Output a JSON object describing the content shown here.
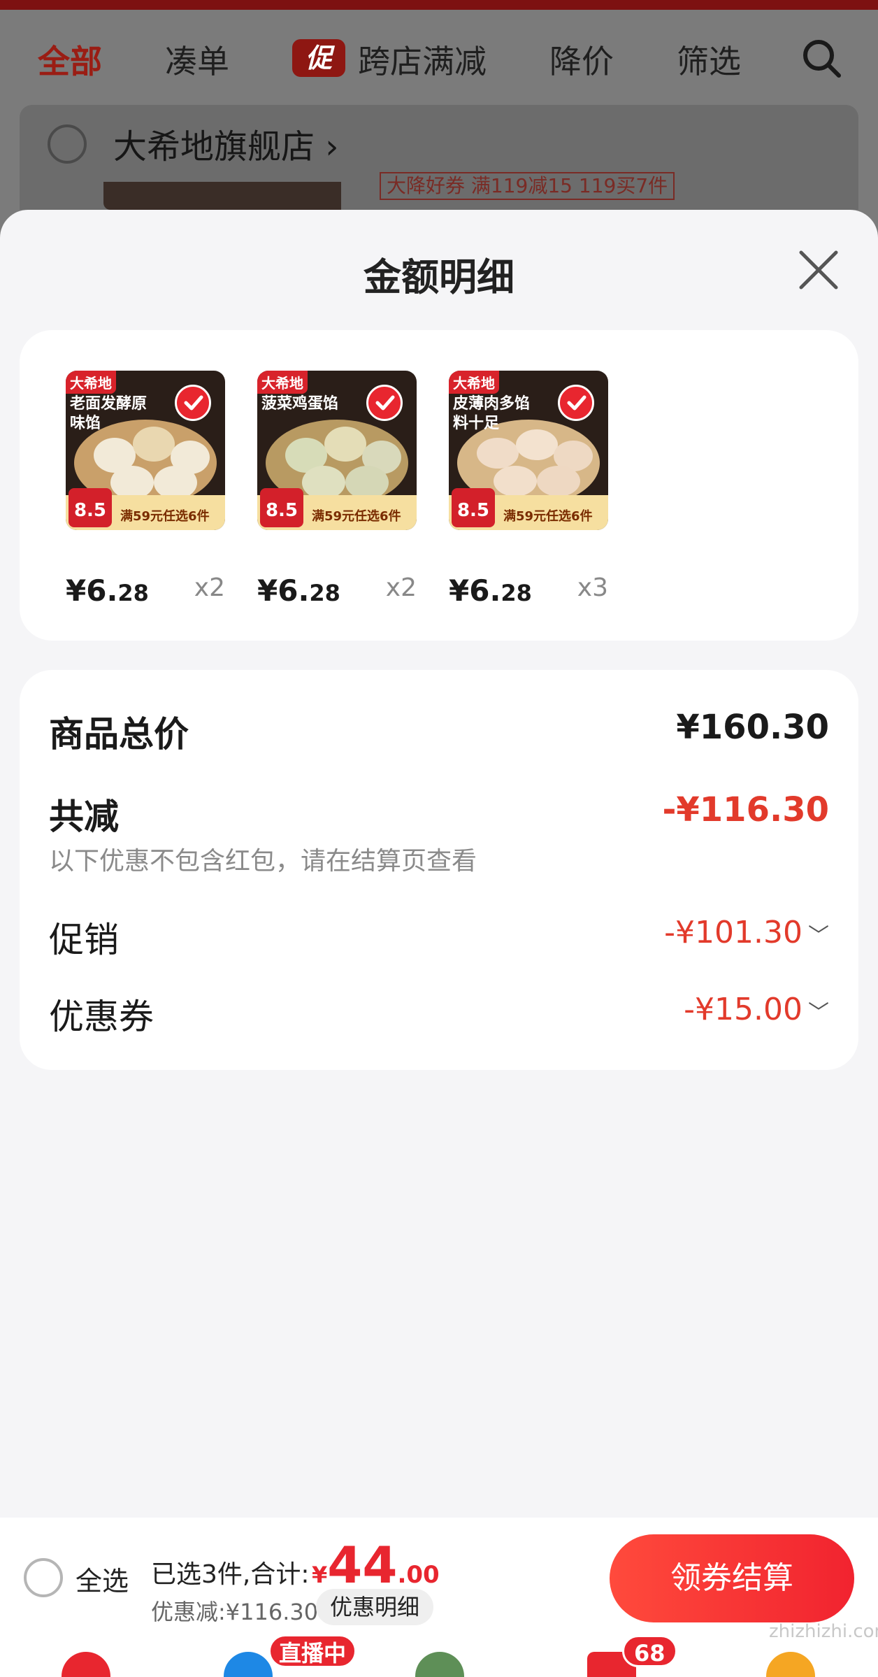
{
  "top_tabs": {
    "all": "全部",
    "bundle": "凑单",
    "promo_badge": "促",
    "cross_store": "跨店满减",
    "price_drop": "降价",
    "filter": "筛选"
  },
  "store": {
    "name": "大希地旗舰店",
    "chevron": "›",
    "peek_tag": "大降好券 满119减15  119买7件"
  },
  "sheet": {
    "title": "金额明细"
  },
  "products": [
    {
      "brand": "大希地",
      "name": "老面发酵原味馅",
      "badge_price": "8.5",
      "promo_text": "满59元任选6件",
      "price_int": "¥6.",
      "price_dec": "28",
      "qty": "x2"
    },
    {
      "brand": "大希地",
      "name": "菠菜鸡蛋馅",
      "badge_price": "8.5",
      "promo_text": "满59元任选6件",
      "price_int": "¥6.",
      "price_dec": "28",
      "qty": "x2"
    },
    {
      "brand": "大希地",
      "name": "皮薄肉多馅料十足",
      "badge_price": "8.5",
      "promo_text": "满59元任选6件",
      "price_int": "¥6.",
      "price_dec": "28",
      "qty": "x3"
    }
  ],
  "summary": {
    "total_label": "商品总价",
    "total_value": "¥160.30",
    "reduce_label": "共减",
    "reduce_value": "-¥116.30",
    "note": "以下优惠不包含红包，请在结算页查看",
    "promo_label": "促销",
    "promo_value": "-¥101.30",
    "coupon_label": "优惠券",
    "coupon_value": "-¥15.00"
  },
  "bottom_bar": {
    "select_all": "全选",
    "summary": "已选3件,合计:",
    "currency": "¥",
    "total_int": "44",
    "total_dec": ".00",
    "saved": "优惠减:¥116.30",
    "detail_button": "优惠明细",
    "pay_button": "领券结算"
  },
  "nav": {
    "live_badge": "直播中",
    "cart_count": "68"
  },
  "watermark": "zhizhizhi.com",
  "colors": {
    "accent_red": "#e8262f",
    "price_red": "#e23a2b"
  }
}
